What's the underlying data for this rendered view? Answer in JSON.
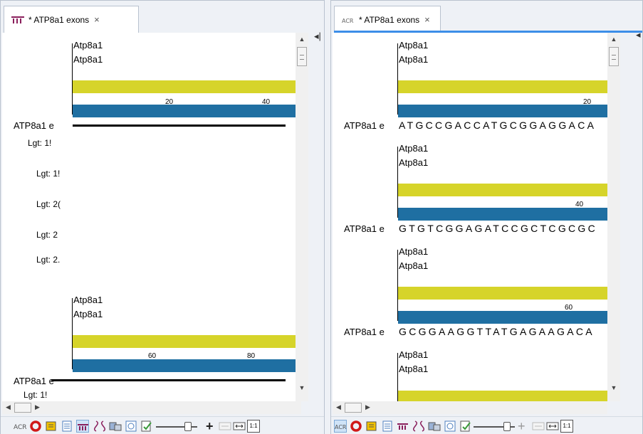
{
  "left_tab": {
    "title": "* ATP8a1 exons",
    "close": "×"
  },
  "right_tab": {
    "title": "* ATP8a1 exons",
    "close": "×"
  },
  "left_view": {
    "track_label_1": "Atp8a1",
    "track_label_2": "Atp8a1",
    "tick_20": "20",
    "tick_40": "40",
    "seq_name_1": "ATP8a1 e",
    "lgt_rows": [
      "Lgt: 1!",
      "Lgt: 1!",
      "Lgt: 2(",
      "Lgt: 2",
      "Lgt: 2."
    ],
    "block2_label_1": "Atp8a1",
    "block2_label_2": "Atp8a1",
    "tick_60": "60",
    "tick_80": "80",
    "seq_name_2": "ATP8a1 e",
    "lgt_bottom": "Lgt: 1!"
  },
  "right_view": {
    "blocks": [
      {
        "label1": "Atp8a1",
        "label2": "Atp8a1",
        "tick": "20",
        "name": "ATP8a1 e",
        "seq": "ATGCCGACCATGCGGAGGACA"
      },
      {
        "label1": "Atp8a1",
        "label2": "Atp8a1",
        "tick": "40",
        "name": "ATP8a1 e",
        "seq": "GTGTCGGAGATCCGCTCGCGC"
      },
      {
        "label1": "Atp8a1",
        "label2": "Atp8a1",
        "tick": "60",
        "name": "ATP8a1 e",
        "seq": "GCGGAAGGTTATGAGAAGACA"
      },
      {
        "label1": "Atp8a1",
        "label2": "Atp8a1"
      }
    ]
  },
  "toolbar": {
    "zoom_one_to_one": "1:1"
  },
  "colors": {
    "annotation_yellow": "#d6d42a",
    "track_blue": "#1f6fa2",
    "tab_accent": "#3c8ee8"
  }
}
